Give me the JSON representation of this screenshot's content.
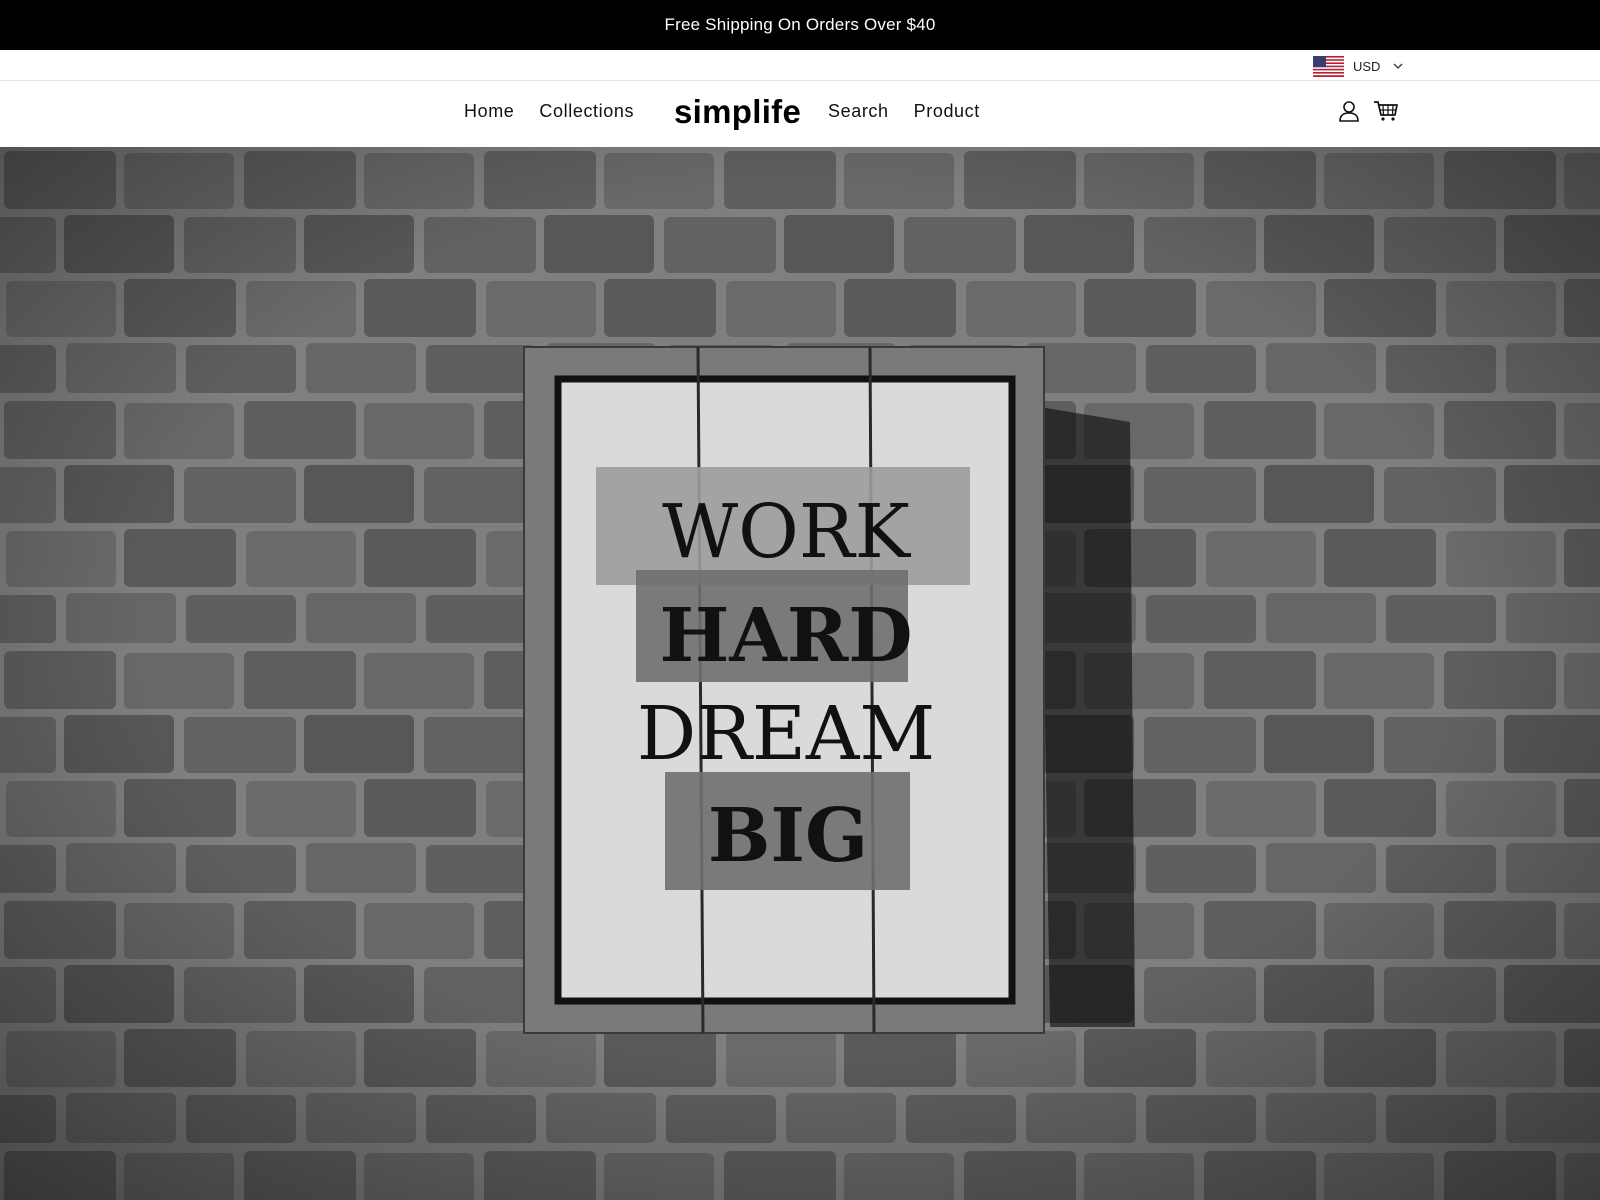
{
  "announcement": {
    "text": "Free Shipping On Orders Over $40"
  },
  "currency": {
    "code": "USD",
    "flag_icon": "us-flag-icon"
  },
  "nav": {
    "left": [
      {
        "label": "Home"
      },
      {
        "label": "Collections"
      }
    ],
    "right": [
      {
        "label": "Search"
      },
      {
        "label": "Product"
      }
    ]
  },
  "brand": {
    "name": "simplife"
  },
  "header_icons": [
    "account-icon",
    "cart-icon"
  ],
  "hero": {
    "image": "brick wall with hanging wooden motivational sign (grayscale)",
    "sign_lines": [
      "WORK",
      "HARD",
      "DREAM",
      "BIG"
    ]
  },
  "colors": {
    "announcement_bg": "#000000",
    "announcement_text": "#ffffff",
    "header_bg": "#ffffff"
  }
}
